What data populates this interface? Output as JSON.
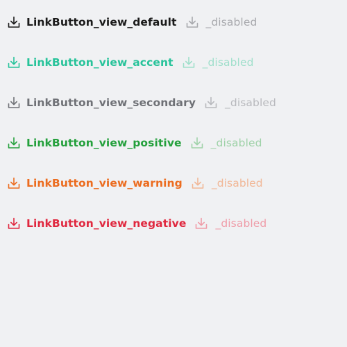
{
  "rows": [
    {
      "key": "default",
      "label": "LinkButton_view_default",
      "disabled_label": "_disabled",
      "color": "#1a1a1a",
      "disabled_color": "#a8a9ad",
      "icon": "download-icon"
    },
    {
      "key": "accent",
      "label": "LinkButton_view_accent",
      "disabled_label": "_disabled",
      "color": "#27c39a",
      "disabled_color": "#9fdfcb",
      "icon": "download-icon"
    },
    {
      "key": "secondary",
      "label": "LinkButton_view_secondary",
      "disabled_label": "_disabled",
      "color": "#6f7176",
      "disabled_color": "#b8b9bd",
      "icon": "download-icon"
    },
    {
      "key": "positive",
      "label": "LinkButton_view_positive",
      "disabled_label": "_disabled",
      "color": "#24a03c",
      "disabled_color": "#9fd2a8",
      "icon": "download-icon"
    },
    {
      "key": "warning",
      "label": "LinkButton_view_warning",
      "disabled_label": "_disabled",
      "color": "#ec6c1f",
      "disabled_color": "#f1b796",
      "icon": "download-icon"
    },
    {
      "key": "negative",
      "label": "LinkButton_view_negative",
      "disabled_label": "_disabled",
      "color": "#e0283f",
      "disabled_color": "#ef9ca8",
      "icon": "download-icon"
    }
  ]
}
